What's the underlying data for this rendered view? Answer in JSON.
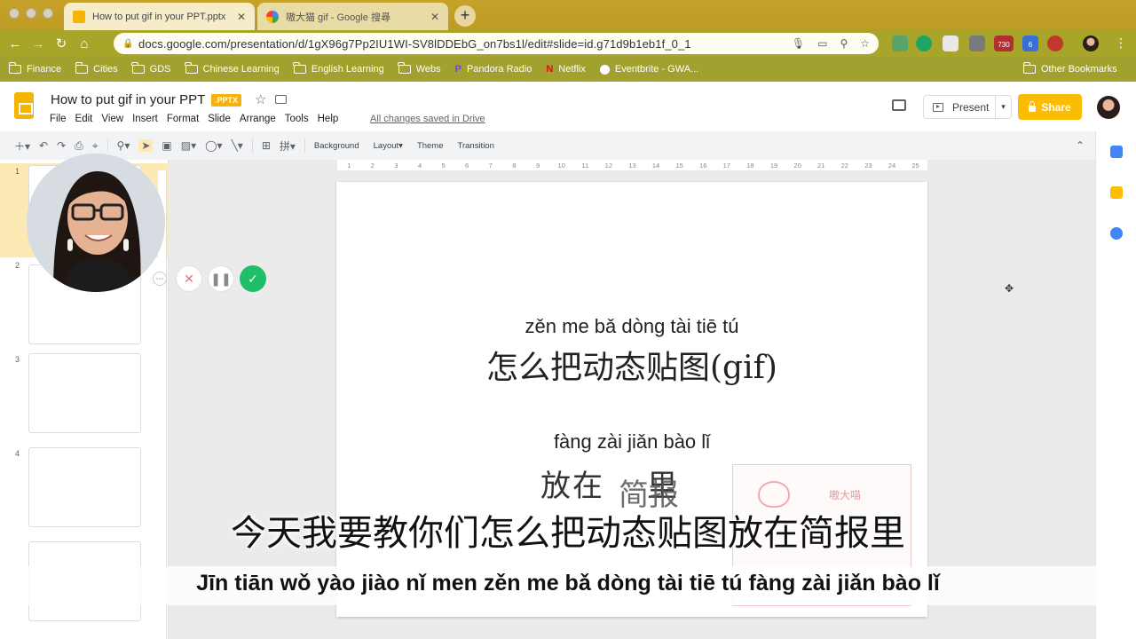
{
  "browser": {
    "tabs": [
      {
        "title": "How to put gif in your PPT.pptx",
        "active": true
      },
      {
        "title": "嗷大猫 gif - Google 搜尋",
        "active": false
      }
    ],
    "url": "docs.google.com/presentation/d/1gX96g7Pp2IU1WI-SV8lDDEbG_on7bs1l/edit#slide=id.g71d9b1eb1f_0_1",
    "extension_badges": [
      "730",
      "6"
    ],
    "bookmarks": [
      "Finance",
      "Cities",
      "GDS",
      "Chinese Learning",
      "English Learning",
      "Webs",
      "Pandora Radio",
      "Netflix",
      "Eventbrite - GWA..."
    ],
    "other_bookmarks": "Other Bookmarks"
  },
  "app": {
    "doc_title": "How to put gif in your PPT",
    "file_badge": ".PPTX",
    "menus": [
      "File",
      "Edit",
      "View",
      "Insert",
      "Format",
      "Slide",
      "Arrange",
      "Tools",
      "Help"
    ],
    "save_status": "All changes saved in Drive",
    "present_label": "Present",
    "share_label": "Share"
  },
  "toolbar": {
    "background": "Background",
    "layout": "Layout",
    "theme": "Theme",
    "transition": "Transition"
  },
  "ruler": [
    "1",
    "2",
    "3",
    "4",
    "5",
    "6",
    "7",
    "8",
    "9",
    "10",
    "11",
    "12",
    "13",
    "14",
    "15",
    "16",
    "17",
    "18",
    "19",
    "20",
    "21",
    "22",
    "23",
    "24",
    "25"
  ],
  "filmstrip": {
    "numbers": [
      "1",
      "2",
      "3",
      "4"
    ]
  },
  "slide": {
    "pinyin_line1": "zěn me bǎ dòng tài tiē tú",
    "hanzi_line1": "怎么把动态贴图(gif)",
    "pinyin_line2": "fàng zài jiǎn bào lǐ",
    "hanzi_line2a": "放在",
    "hanzi_line2b": "简报",
    "hanzi_line2c": "里",
    "gif_label": "嗷大喵"
  },
  "subtitles": {
    "chinese": "今天我要教你们怎么把动态贴图放在简报里",
    "pinyin": "Jīn tiān wǒ yào jiào nǐ men zěn me bǎ dòng tài tiē tú fàng zài jiǎn bào lǐ"
  },
  "colors": {
    "share": "#fbbc04",
    "record_confirm": "#1fbf6a",
    "record_cancel": "#e57373",
    "slides_brand": "#f4b400"
  }
}
